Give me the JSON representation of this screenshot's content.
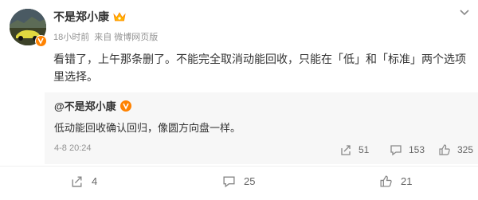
{
  "post": {
    "username": "不是郑小康",
    "time": "18小时前",
    "source": "来自 微博网页版",
    "text": "看错了，上午那条删了。不能完全取消动能回收，只能在「低」和「标准」两个选项里选择。"
  },
  "repost": {
    "username": "@不是郑小康",
    "text": "低动能回收确认回归，像圆方向盘一样。",
    "date": "4-8 20:24",
    "actions": {
      "share": "51",
      "comment": "153",
      "like": "325"
    }
  },
  "actions": {
    "share": "4",
    "comment": "25",
    "like": "21"
  },
  "colors": {
    "verified": "#ff8200",
    "repost_bg": "#f7f7f7",
    "meta": "#939393"
  }
}
